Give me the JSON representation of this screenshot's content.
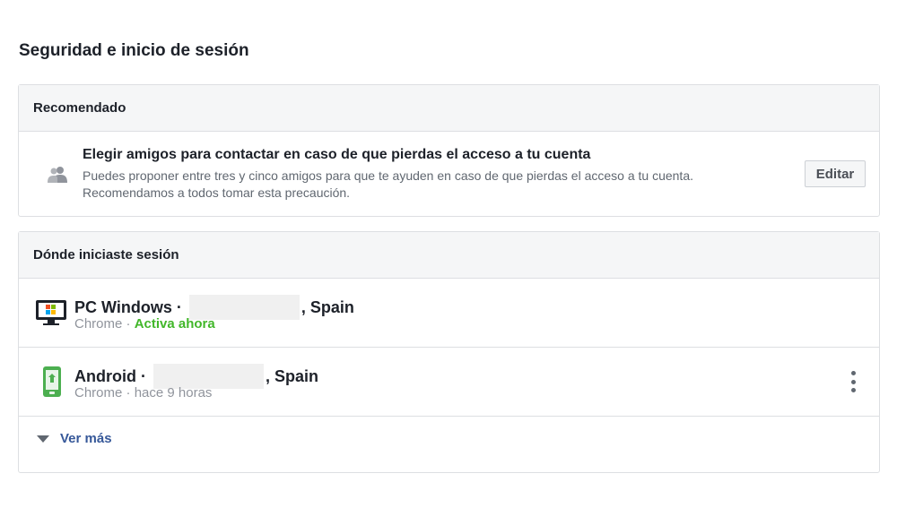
{
  "page": {
    "title": "Seguridad e inicio de sesión"
  },
  "recommended": {
    "header": "Recomendado",
    "item": {
      "icon": "friends-icon",
      "title": "Elegir amigos para contactar en caso de que pierdas el acceso a tu cuenta",
      "description_line1": "Puedes proponer entre tres y cinco amigos para que te ayuden en caso de que pierdas el acceso a tu cuenta.",
      "description_line2": "Recomendamos a todos tomar esta precaución.",
      "button_label": "Editar"
    }
  },
  "sessions": {
    "header": "Dónde iniciaste sesión",
    "items": [
      {
        "icon": "windows-pc-icon",
        "device": "PC Windows ·",
        "location": ", Spain",
        "browser": "Chrome ·",
        "status": "Activa ahora"
      },
      {
        "icon": "android-phone-icon",
        "device": "Android ·",
        "location": ", Spain",
        "browser": "Chrome ·",
        "status": "hace 9 horas",
        "menu_icon": "more-options-icon"
      }
    ],
    "see_more": "Ver más"
  },
  "colors": {
    "active_status": "#42b72a",
    "link": "#365899",
    "header_bg": "#f5f6f7",
    "border": "#dddfe2"
  }
}
